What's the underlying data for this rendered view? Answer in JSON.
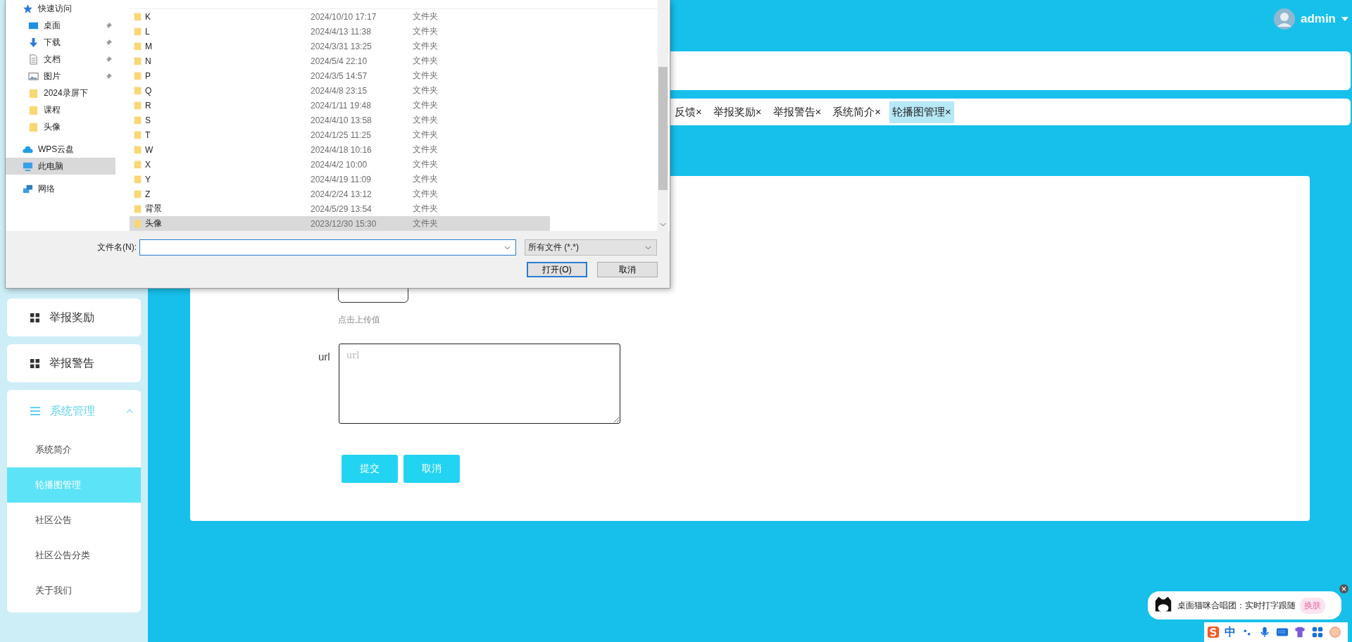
{
  "header": {
    "user_name": "admin"
  },
  "tabs": [
    {
      "label": "反馈",
      "close": "×",
      "selected": false
    },
    {
      "label": "举报奖励",
      "close": "×",
      "selected": false
    },
    {
      "label": "举报警告",
      "close": "×",
      "selected": false
    },
    {
      "label": "系统简介",
      "close": "×",
      "selected": false
    },
    {
      "label": "轮播图管理",
      "close": "×",
      "selected": true
    }
  ],
  "sidebar": {
    "items": [
      {
        "label": "举报奖励"
      },
      {
        "label": "举报警告"
      }
    ],
    "group": {
      "label": "系统管理",
      "expanded": true,
      "children": [
        {
          "label": "系统简介",
          "selected": false
        },
        {
          "label": "轮播图管理",
          "selected": true
        },
        {
          "label": "社区公告",
          "selected": false
        },
        {
          "label": "社区公告分类",
          "selected": false
        },
        {
          "label": "关于我们",
          "selected": false
        }
      ]
    }
  },
  "form": {
    "upload_hint": "点击上传值",
    "url_label": "url",
    "url_placeholder": "url",
    "buttons": [
      "提交",
      "取消"
    ]
  },
  "file_dialog": {
    "nav": [
      {
        "label": "快速访问",
        "kind": "star",
        "pinned": false,
        "selected": false,
        "sub": false
      },
      {
        "label": "桌面",
        "kind": "desktop",
        "pinned": true,
        "selected": false,
        "sub": true
      },
      {
        "label": "下载",
        "kind": "download",
        "pinned": true,
        "selected": false,
        "sub": true
      },
      {
        "label": "文档",
        "kind": "document",
        "pinned": true,
        "selected": false,
        "sub": true
      },
      {
        "label": "图片",
        "kind": "image",
        "pinned": true,
        "selected": false,
        "sub": true
      },
      {
        "label": "2024录屏下",
        "kind": "folder",
        "pinned": false,
        "selected": false,
        "sub": true
      },
      {
        "label": "课程",
        "kind": "folder",
        "pinned": false,
        "selected": false,
        "sub": true
      },
      {
        "label": "头像",
        "kind": "folder",
        "pinned": false,
        "selected": false,
        "sub": true
      },
      {
        "label": "WPS云盘",
        "kind": "cloud",
        "pinned": false,
        "selected": false,
        "sub": false
      },
      {
        "label": "此电脑",
        "kind": "computer",
        "pinned": false,
        "selected": true,
        "sub": false
      },
      {
        "label": "网络",
        "kind": "network",
        "pinned": false,
        "selected": false,
        "sub": false
      }
    ],
    "files": [
      {
        "name": "K",
        "date": "2024/10/10 17:17",
        "type": "文件夹",
        "selected": false
      },
      {
        "name": "L",
        "date": "2024/4/13 11:38",
        "type": "文件夹",
        "selected": false
      },
      {
        "name": "M",
        "date": "2024/3/31 13:25",
        "type": "文件夹",
        "selected": false
      },
      {
        "name": "N",
        "date": "2024/5/4 22:10",
        "type": "文件夹",
        "selected": false
      },
      {
        "name": "P",
        "date": "2024/3/5 14:57",
        "type": "文件夹",
        "selected": false
      },
      {
        "name": "Q",
        "date": "2024/4/8 23:15",
        "type": "文件夹",
        "selected": false
      },
      {
        "name": "R",
        "date": "2024/1/11 19:48",
        "type": "文件夹",
        "selected": false
      },
      {
        "name": "S",
        "date": "2024/4/10 13:58",
        "type": "文件夹",
        "selected": false
      },
      {
        "name": "T",
        "date": "2024/1/25 11:25",
        "type": "文件夹",
        "selected": false
      },
      {
        "name": "W",
        "date": "2024/4/18 10:16",
        "type": "文件夹",
        "selected": false
      },
      {
        "name": "X",
        "date": "2024/4/2 10:00",
        "type": "文件夹",
        "selected": false
      },
      {
        "name": "Y",
        "date": "2024/4/19 11:09",
        "type": "文件夹",
        "selected": false
      },
      {
        "name": "Z",
        "date": "2024/2/24 13:12",
        "type": "文件夹",
        "selected": false
      },
      {
        "name": "背景",
        "date": "2024/5/29 13:54",
        "type": "文件夹",
        "selected": false
      },
      {
        "name": "头像",
        "date": "2023/12/30 15:30",
        "type": "文件夹",
        "selected": true
      }
    ],
    "filename_label": "文件名(N):",
    "filter": "所有文件 (*.*)",
    "buttons": [
      "打开(O)",
      "取消"
    ]
  },
  "ime": {
    "message": "桌面猫咪合唱团：实时打字跟随",
    "skin_button": "换肤",
    "mode": "中"
  }
}
